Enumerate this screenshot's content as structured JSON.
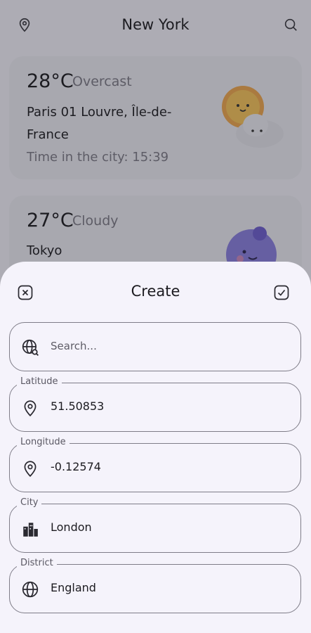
{
  "header": {
    "title": "New York",
    "location_icon": "map-pin-icon",
    "search_icon": "search-icon"
  },
  "cards": [
    {
      "temp": "28°C",
      "condition": "Overcast",
      "place": "Paris 01 Louvre, Île-de-France",
      "time": "Time in the city: 15:39",
      "icon": "sun-cloud-icon"
    },
    {
      "temp": "27°C",
      "condition": "Cloudy",
      "place": "Tokyo",
      "icon": "moon-icon"
    }
  ],
  "sheet": {
    "title": "Create",
    "close_icon": "close-icon",
    "confirm_icon": "confirm-check-icon",
    "search": {
      "placeholder": "Search...",
      "icon": "globe-search-icon"
    },
    "latitude": {
      "label": "Latitude",
      "value": "51.50853",
      "icon": "map-pin-icon"
    },
    "longitude": {
      "label": "Longitude",
      "value": "-0.12574",
      "icon": "map-pin-icon"
    },
    "city": {
      "label": "City",
      "value": "London",
      "icon": "city-icon"
    },
    "district": {
      "label": "District",
      "value": "England",
      "icon": "globe-icon"
    }
  }
}
